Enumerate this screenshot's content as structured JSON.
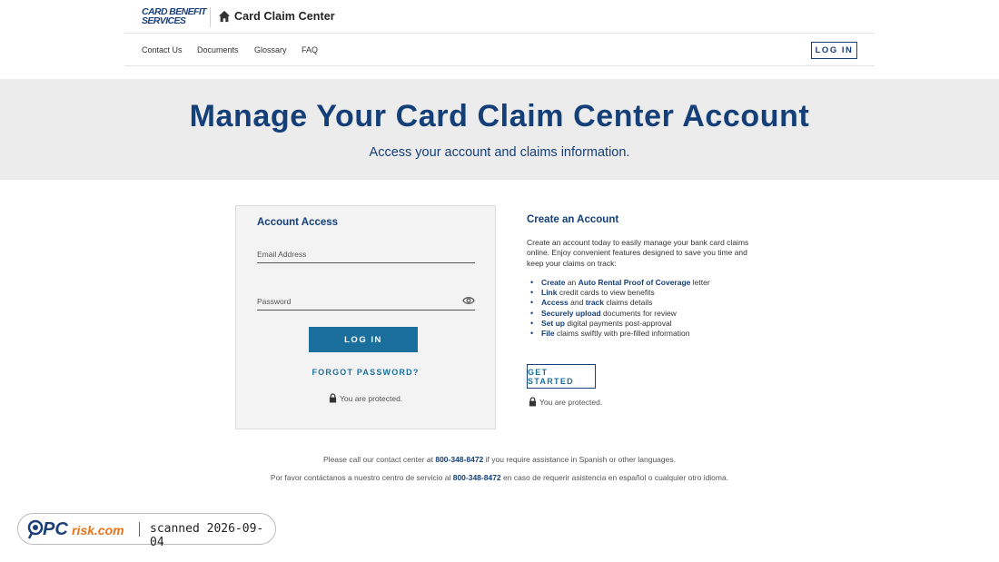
{
  "header": {
    "logo_line1": "CARD BENEFIT",
    "logo_line2": "SERVICES",
    "brand_title": "Card Claim Center",
    "login_label": "LOG IN"
  },
  "nav": {
    "items": [
      "Contact Us",
      "Documents",
      "Glossary",
      "FAQ"
    ]
  },
  "hero": {
    "title": "Manage Your Card Claim Center Account",
    "subtitle": "Access your account and claims information."
  },
  "login_panel": {
    "title": "Account Access",
    "email_placeholder": "Email Address",
    "password_placeholder": "Password",
    "login_button": "LOG IN",
    "forgot_password": "FORGOT PASSWORD?",
    "protected_text": "You are protected."
  },
  "create_account": {
    "title": "Create an Account",
    "intro": "Create an account today to easily manage your bank card claims online. Enjoy convenient features designed to save you time and keep your claims on track:",
    "features": [
      {
        "parts": [
          {
            "b": "Create"
          },
          {
            "t": " an "
          },
          {
            "b": "Auto Rental Proof of Coverage"
          },
          {
            "t": " letter"
          }
        ]
      },
      {
        "parts": [
          {
            "b": "Link"
          },
          {
            "t": " credit cards to view benefits"
          }
        ]
      },
      {
        "parts": [
          {
            "b": "Access"
          },
          {
            "t": " and "
          },
          {
            "b": "track"
          },
          {
            "t": " claims details"
          }
        ]
      },
      {
        "parts": [
          {
            "b": "Securely upload"
          },
          {
            "t": " documents for review"
          }
        ]
      },
      {
        "parts": [
          {
            "b": "Set up"
          },
          {
            "t": " digital payments post-approval"
          }
        ]
      },
      {
        "parts": [
          {
            "b": "File"
          },
          {
            "t": " claims swiftly with pre-filled information"
          }
        ]
      }
    ],
    "get_started": "GET STARTED",
    "protected_text": "You are protected."
  },
  "assistance": {
    "en_before": "Please call our contact center at ",
    "en_phone": "800-348-8472",
    "en_after": " if you require assistance in Spanish or other languages.",
    "es_before": "Por favor contáctanos a nuestro centro de servicio al ",
    "es_phone": "800-348-8472",
    "es_after": " en caso de requerir asistencia en español o cualquier otro idioma."
  },
  "watermark": {
    "brand": "PCrisk.com",
    "text": "scanned 2026-09-04"
  },
  "colors": {
    "brand_navy": "#143f78",
    "button_blue": "#1a6f9c",
    "hero_bg": "#ececec"
  }
}
